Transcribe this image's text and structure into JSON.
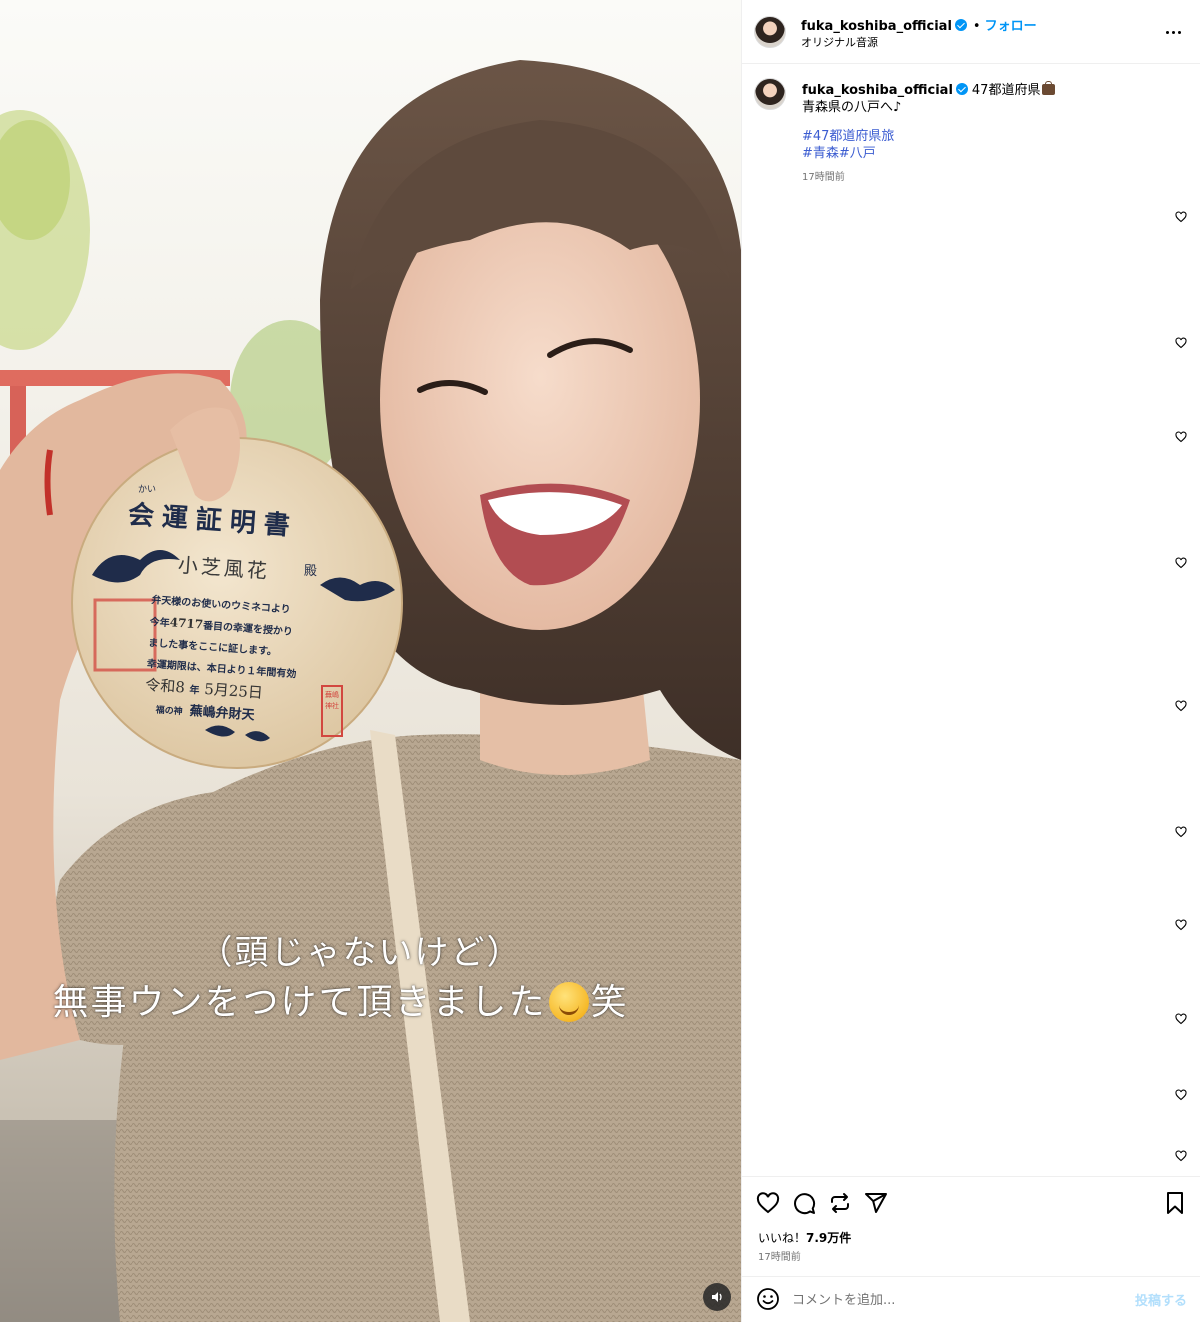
{
  "media": {
    "overlay_line1": "（頭じゃないけど）",
    "overlay_line2_a": "無事ウンをつけて頂きました",
    "overlay_line2_b": "笑",
    "emoji_icon": "smiling-face-icon",
    "plaque": {
      "title": "会運証明書",
      "ruby": "かい",
      "name": "小芝風花",
      "honorific": "殿",
      "line1": "弁天様のお使いのウミネコより",
      "line2_a": "今年",
      "line2_num": "4717",
      "line2_b": "番目の幸運を授かり",
      "line3": "ました事をここに証します。",
      "line4": "幸運期限は、本日より１年間有効",
      "date_era": "令和8",
      "date_year": "年",
      "date_month": "5月",
      "date_day": "25日",
      "shrine_prefix": "福の神",
      "shrine": "蕪嶋弁財天",
      "seal": "蕪嶋神社"
    },
    "mute_icon": "speaker-icon"
  },
  "header": {
    "username": "fuka_koshiba_official",
    "separator": "•",
    "follow_label": "フォロー",
    "audio": "オリジナル音源"
  },
  "caption": {
    "username": "fuka_koshiba_official",
    "tagline": "47都道府県",
    "line2": "青森県の八戸へ♪",
    "hashtag1": "#47都道府県旅",
    "hashtag2": "#青森#八戸",
    "time": "17時間前"
  },
  "actions": {
    "likes_prefix": "いいね！",
    "likes_count": "7.9万件",
    "time": "17時間前"
  },
  "comment": {
    "placeholder": "コメントを追加...",
    "post_label": "投稿する"
  },
  "colors": {
    "accent": "#0095f6",
    "hashtag": "#3b5cd1",
    "muted": "#737373"
  }
}
